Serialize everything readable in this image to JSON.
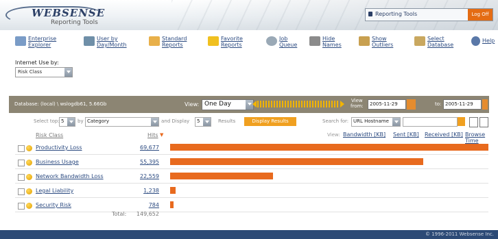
{
  "header": {
    "logo_name": "WEBSENSE",
    "logo_subtitle": "Reporting Tools",
    "reporting_tools_label": "Reporting Tools",
    "logoff_label": "Log Off"
  },
  "toolbar": [
    {
      "id": "enterprise-explorer",
      "label": "Enterprise\nExplorer",
      "icon": "grid-icon",
      "color": "#7a9cc7"
    },
    {
      "id": "user-by-day-month",
      "label": "User by\nDay/Month",
      "icon": "people-icon",
      "color": "#6f8fa8"
    },
    {
      "id": "standard-reports",
      "label": "Standard\nReports",
      "icon": "document-icon",
      "color": "#e8b04a"
    },
    {
      "id": "favorite-reports",
      "label": "Favorite\nReports",
      "icon": "star-icon",
      "color": "#f0c020"
    },
    {
      "id": "job-queue",
      "label": "Job\nQueue",
      "icon": "clock-icon",
      "color": "#9aa9b6"
    },
    {
      "id": "hide-names",
      "label": "Hide\nNames",
      "icon": "mask-icon",
      "color": "#8b8b8b"
    },
    {
      "id": "show-outliers",
      "label": "Show\nOutliers",
      "icon": "outlier-chart-icon",
      "color": "#c8a050"
    },
    {
      "id": "select-database",
      "label": "Select\nDatabase",
      "icon": "database-icon",
      "color": "#c9a860"
    },
    {
      "id": "help",
      "label": "Help",
      "icon": "help-icon",
      "color": "#5a78a8"
    }
  ],
  "filter": {
    "label": "Internet Use by:",
    "selected": "Risk Class"
  },
  "database_bar": {
    "database_text": "Database: (local) \\ wslogdb61, 5.66Gb",
    "view_label": "View:",
    "view_selected": "One Day",
    "view_from_label": "View\nfrom:",
    "from_date": "2005-11-29",
    "to_label": "to:",
    "to_date": "2005-11-29"
  },
  "controls": {
    "select_top_label": "Select top:",
    "top_value": "5",
    "by_label": "by",
    "by_value": "Category",
    "and_display_label": "and Display",
    "display_value": "5",
    "results_label": "Results",
    "display_button": "Display Results",
    "search_for_label": "Search for:",
    "search_field_value": "URL Hostname"
  },
  "table": {
    "col_risk_class": "Risk Class",
    "col_hits": "Hits",
    "views_label": "View:",
    "view_links": [
      "Bandwidth [KB]",
      "Sent [KB]",
      "Received [KB]",
      "Browse Time"
    ],
    "rows": [
      {
        "label": "Productivity Loss",
        "hits": "69,677",
        "value": 69677
      },
      {
        "label": "Business Usage",
        "hits": "55,395",
        "value": 55395
      },
      {
        "label": "Network Bandwidth Loss",
        "hits": "22,559",
        "value": 22559
      },
      {
        "label": "Legal Liability",
        "hits": "1,238",
        "value": 1238
      },
      {
        "label": "Security Risk",
        "hits": "784",
        "value": 784
      }
    ],
    "total_label": "Total:",
    "total_value": "149,652"
  },
  "footer": {
    "copyright": "© 1996-2011 Websense Inc."
  },
  "colors": {
    "accent_orange": "#e86a1e",
    "db_bar": "#8c8573",
    "footer": "#2c4a76",
    "link": "#2b4a80"
  }
}
